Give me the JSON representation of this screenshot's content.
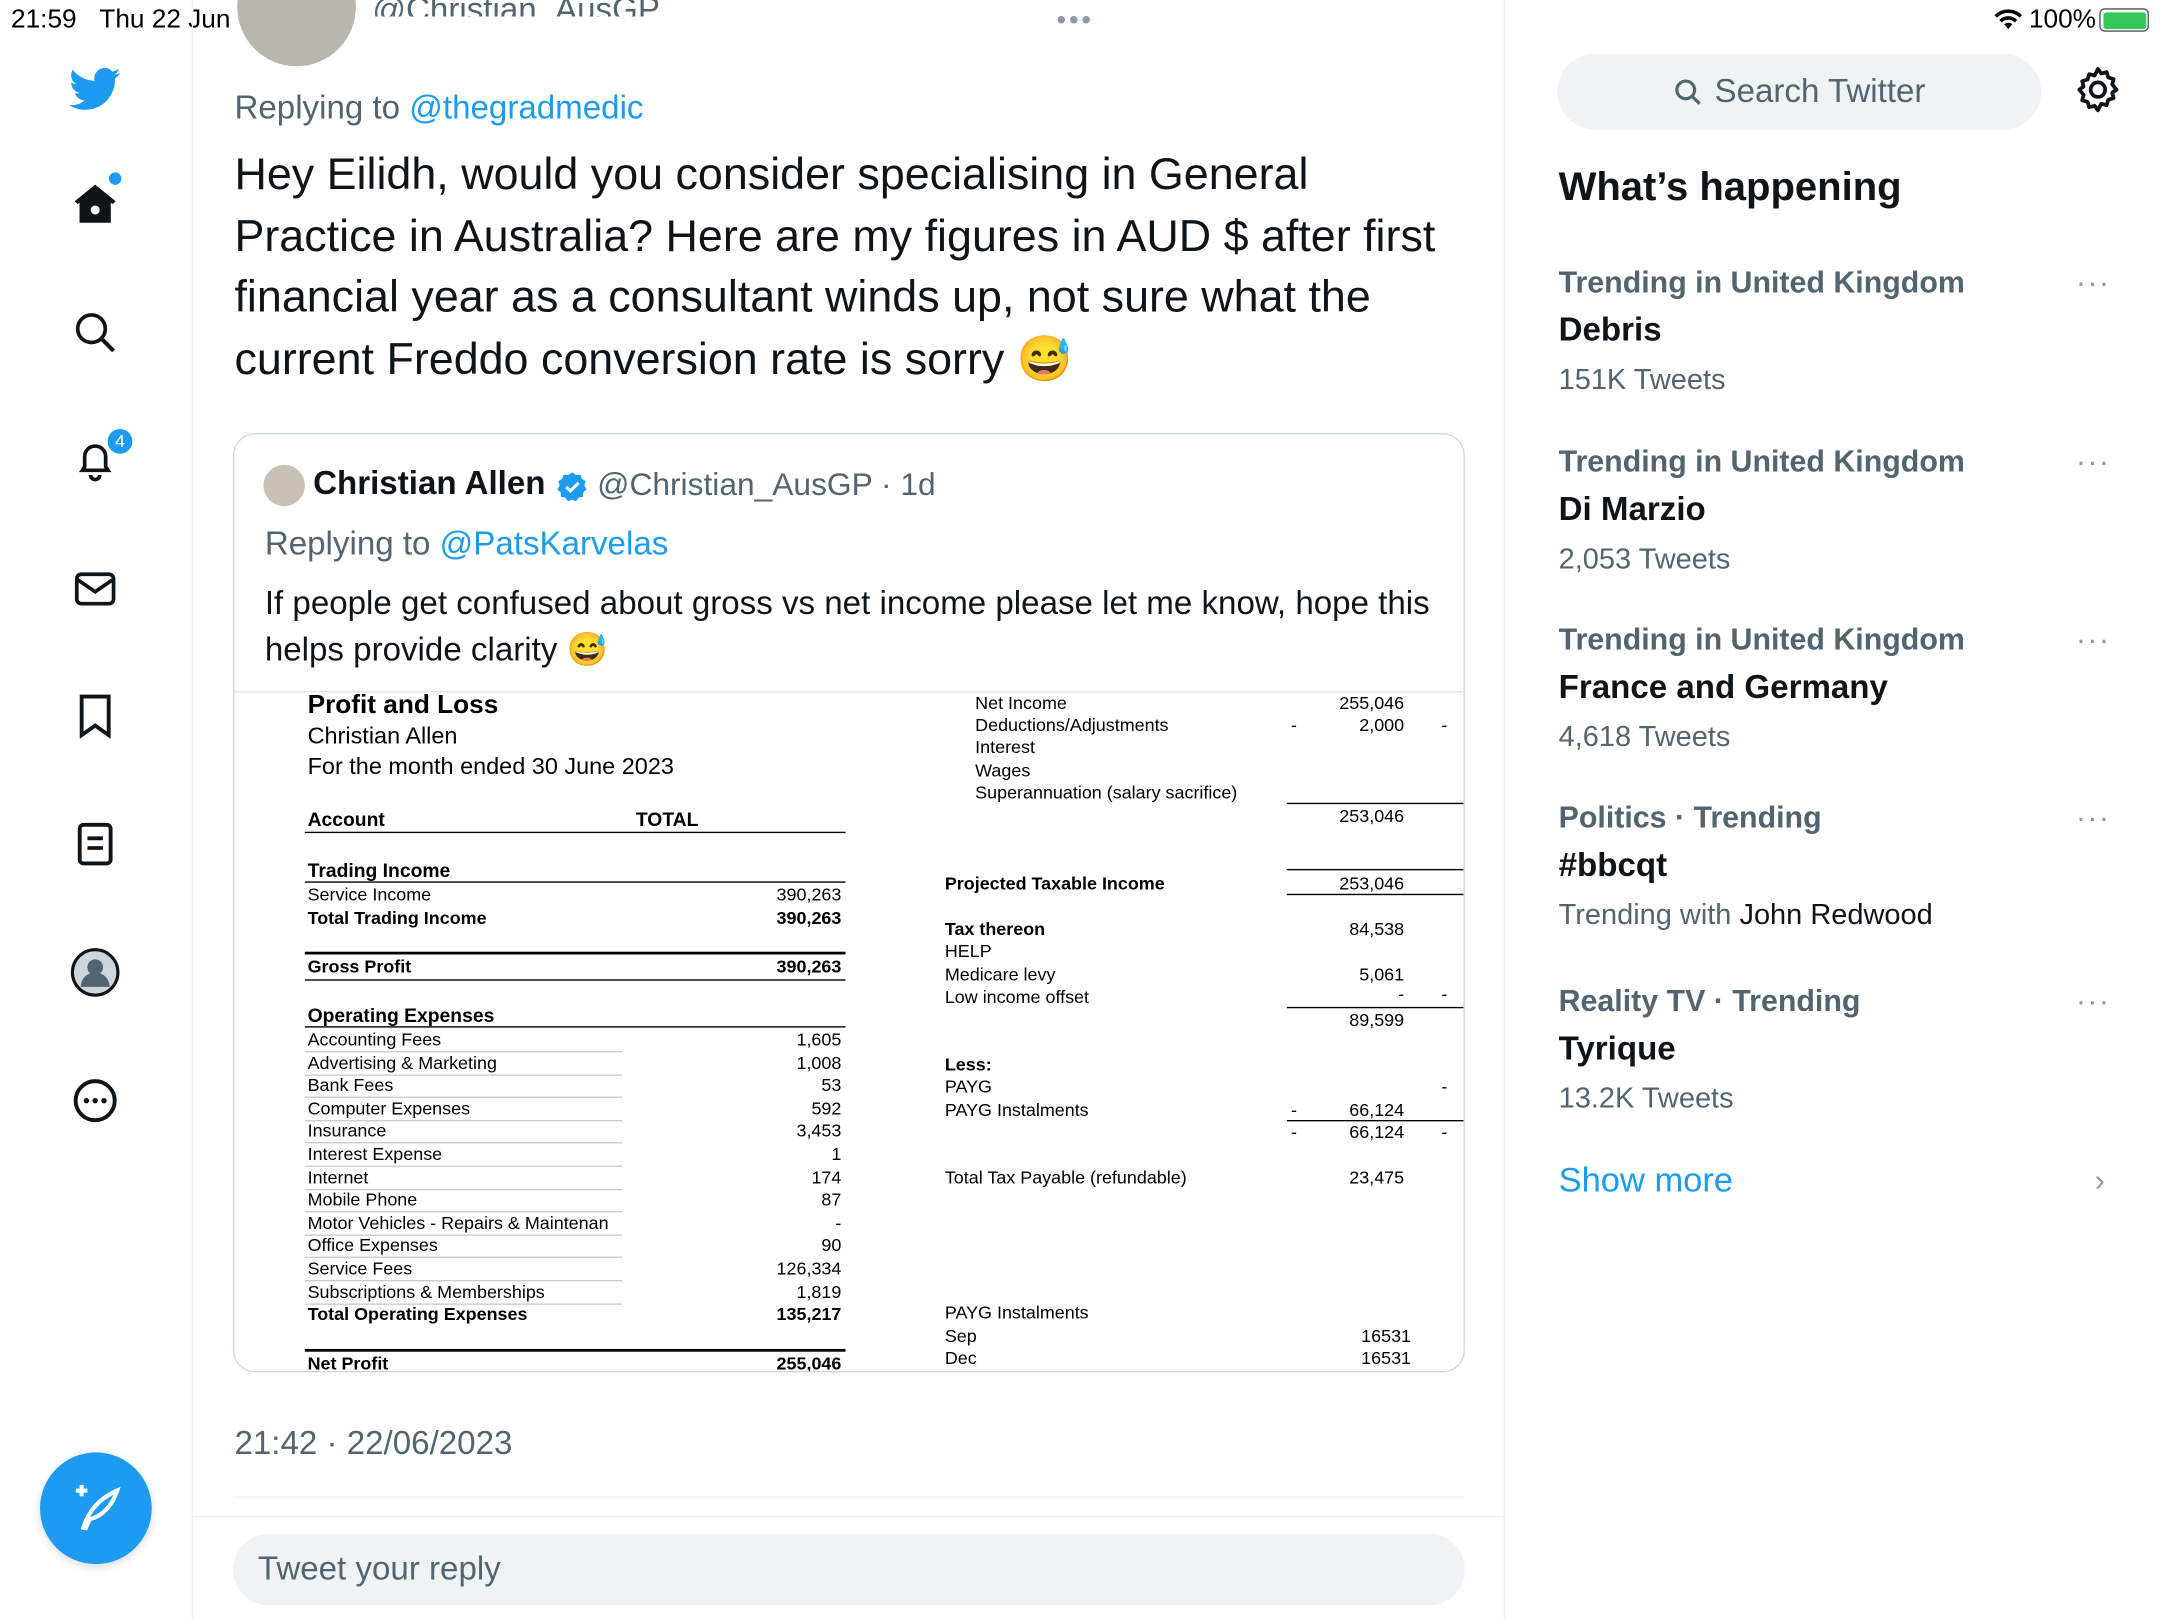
{
  "status_bar": {
    "time": "21:59",
    "date": "Thu 22 Jun",
    "battery": "100%"
  },
  "top_more": "•••",
  "sidebar": {
    "notification_count": "4",
    "icons": [
      "twitter-logo-icon",
      "home-icon",
      "search-icon",
      "notifications-icon",
      "messages-icon",
      "bookmarks-icon",
      "lists-icon",
      "profile-icon",
      "more-icon"
    ]
  },
  "tweet": {
    "author_handle_partial": "@Christian_AusGP",
    "replying_prefix": "Replying to ",
    "replying_to": "@thegradmedic",
    "text": "Hey Eilidh, would you consider specialising in General Practice in Australia? Here are my figures in AUD $ after first financial year as a consultant winds up, not sure what the current Freddo conversion rate is sorry 😅",
    "timestamp": "21:42 · 22/06/2023"
  },
  "quoted": {
    "name": "Christian Allen",
    "handle": "@Christian_AusGP",
    "age": "· 1d",
    "replying_prefix": "Replying to ",
    "replying_to": "@PatsKarvelas",
    "text": "If people get confused about gross vs net income please let me know, hope this helps provide clarity 😅"
  },
  "pnl": {
    "title": "Profit and Loss",
    "name": "Christian Allen",
    "period": "For the month ended 30 June 2023",
    "col_account": "Account",
    "col_total": "TOTAL",
    "trading_income": "Trading Income",
    "service_income": [
      "Service Income",
      "390,263"
    ],
    "total_trading_income": [
      "Total Trading Income",
      "390,263"
    ],
    "gross_profit": [
      "Gross Profit",
      "390,263"
    ],
    "operating_expenses": "Operating Expenses",
    "expenses": [
      [
        "Accounting Fees",
        "1,605"
      ],
      [
        "Advertising & Marketing",
        "1,008"
      ],
      [
        "Bank Fees",
        "53"
      ],
      [
        "Computer Expenses",
        "592"
      ],
      [
        "Insurance",
        "3,453"
      ],
      [
        "Interest Expense",
        "1"
      ],
      [
        "Internet",
        "174"
      ],
      [
        "Mobile Phone",
        "87"
      ],
      [
        "Motor Vehicles - Repairs & Maintenan",
        "-"
      ],
      [
        "Office Expenses",
        "90"
      ],
      [
        "Service Fees",
        "126,334"
      ],
      [
        "Subscriptions & Memberships",
        "1,819"
      ]
    ],
    "total_operating_expenses": [
      "Total Operating Expenses",
      "135,217"
    ],
    "net_profit": [
      "Net Profit",
      "255,046"
    ],
    "right": {
      "net_income": [
        "Net Income",
        "255,046"
      ],
      "deductions": [
        "Deductions/Adjustments",
        "2,000"
      ],
      "interest": "Interest",
      "wages": "Wages",
      "super": "Superannuation (salary sacrifice)",
      "subtotal": "253,046",
      "projected": [
        "Projected Taxable Income",
        "253,046"
      ],
      "tax_thereon": [
        "Tax thereon",
        "84,538"
      ],
      "help": "HELP",
      "medicare": [
        "Medicare levy",
        "5,061"
      ],
      "low_income": "Low income offset",
      "tax_total": "89,599",
      "less": "Less:",
      "payg": "PAYG",
      "payg_inst": [
        "PAYG Instalments",
        "66,124"
      ],
      "payg_total": "66,124",
      "total_tax": [
        "Total Tax Payable (refundable)",
        "23,475"
      ],
      "inst_header": "PAYG Instalments",
      "sep": [
        "Sep",
        "16531"
      ],
      "dec": [
        "Dec",
        "16531"
      ],
      "dash": "-"
    }
  },
  "reply_placeholder": "Tweet your reply",
  "right": {
    "search_placeholder": "Search Twitter",
    "heading": "What’s happening",
    "trends": [
      {
        "context": "Trending in United Kingdom",
        "name": "Debris",
        "count": "151K Tweets"
      },
      {
        "context": "Trending in United Kingdom",
        "name": "Di Marzio",
        "count": "2,053 Tweets"
      },
      {
        "context": "Trending in United Kingdom",
        "name": "France and Germany",
        "count": "4,618 Tweets"
      },
      {
        "context": "Politics · Trending",
        "name": "#bbcqt",
        "count_prefix": "Trending with ",
        "count_name": "John Redwood"
      },
      {
        "context": "Reality TV · Trending",
        "name": "Tyrique",
        "count": "13.2K Tweets"
      }
    ],
    "show_more": "Show more"
  }
}
